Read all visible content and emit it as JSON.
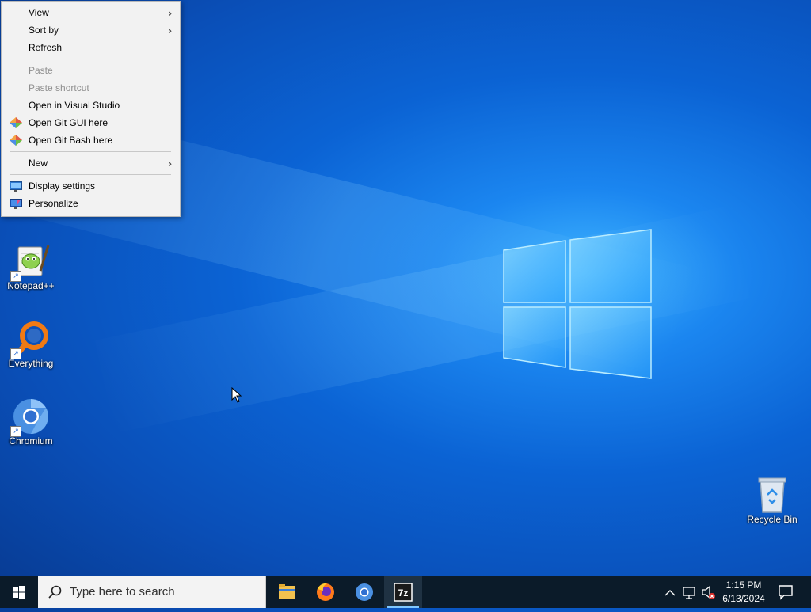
{
  "context_menu": {
    "items": [
      {
        "label": "View",
        "submenu": true
      },
      {
        "label": "Sort by",
        "submenu": true
      },
      {
        "label": "Refresh"
      },
      {
        "label": "Paste",
        "disabled": true
      },
      {
        "label": "Paste shortcut",
        "disabled": true
      },
      {
        "label": "Open in Visual Studio"
      },
      {
        "label": "Open Git GUI here",
        "icon": "git-gui-icon"
      },
      {
        "label": "Open Git Bash here",
        "icon": "git-bash-icon"
      },
      {
        "label": "New",
        "submenu": true
      },
      {
        "label": "Display settings",
        "icon": "display-settings-icon"
      },
      {
        "label": "Personalize",
        "icon": "personalize-icon"
      }
    ],
    "submenu_arrow": "›"
  },
  "desktop_icons": [
    {
      "label": "Notepad++",
      "icon": "notepadpp-icon"
    },
    {
      "label": "Everything",
      "icon": "everything-icon"
    },
    {
      "label": "Chromium",
      "icon": "chromium-icon"
    },
    {
      "label": "Recycle Bin",
      "icon": "recycle-bin-icon"
    }
  ],
  "taskbar": {
    "search_placeholder": "Type here to search",
    "apps": [
      {
        "name": "File Explorer",
        "icon": "file-explorer-icon"
      },
      {
        "name": "Firefox",
        "icon": "firefox-icon"
      },
      {
        "name": "Chromium",
        "icon": "chromium-icon"
      },
      {
        "name": "7-Zip",
        "icon": "7zip-icon",
        "active": true
      }
    ],
    "time": "1:15 PM",
    "date": "6/13/2024"
  },
  "colors": {
    "taskbar": "#0b1b29",
    "menu_bg": "#f2f2f2",
    "desktop_accent": "#0b63d4"
  }
}
